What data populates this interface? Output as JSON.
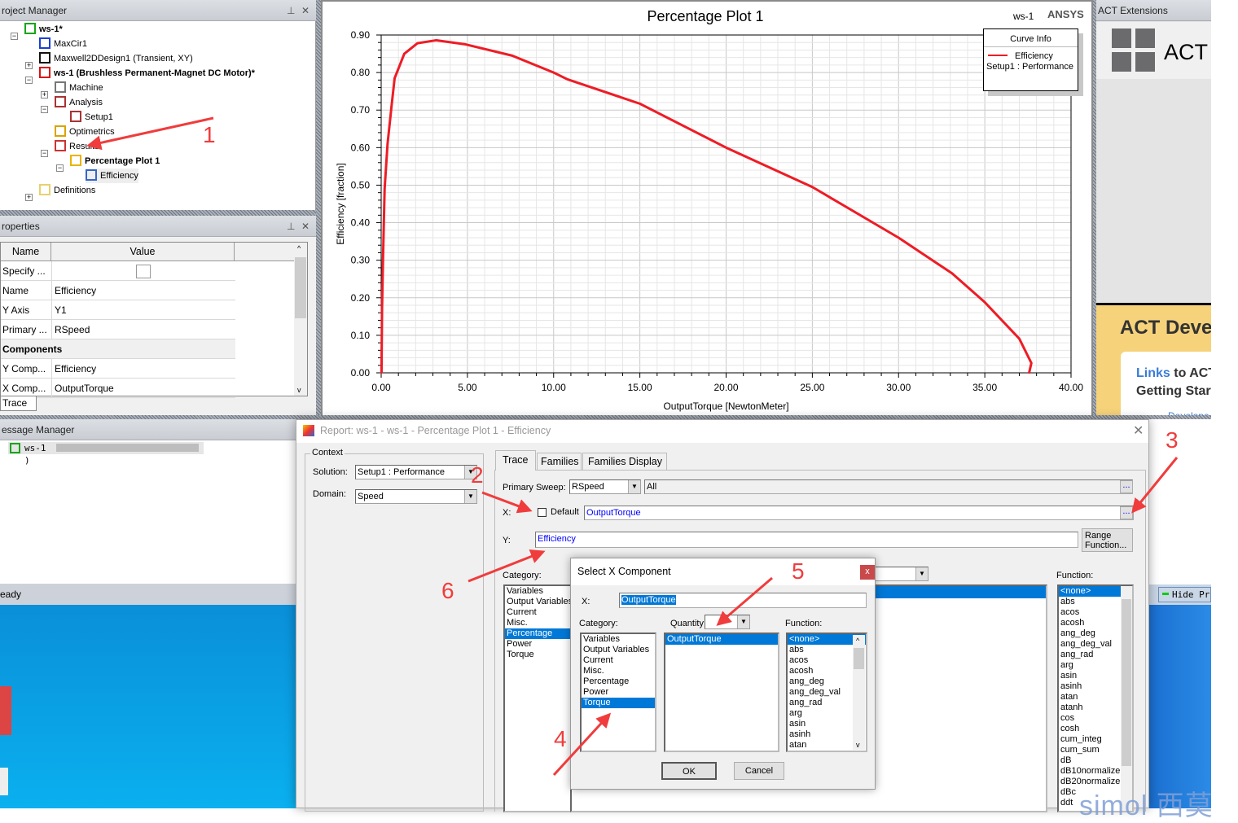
{
  "project_manager": {
    "title": "roject Manager",
    "pin_icon": "pin-icon",
    "tree": [
      {
        "label": "ws-1*",
        "bold": true,
        "icon": "project-icon"
      },
      {
        "label": "MaxCir1",
        "icon": "circuit-icon"
      },
      {
        "label": "Maxwell2DDesign1 (Transient, XY)",
        "icon": "maxwell-design-icon"
      },
      {
        "label": "ws-1 (Brushless Permanent-Magnet DC Motor)*",
        "bold": true,
        "icon": "rmxprt-icon"
      },
      {
        "label": "Machine",
        "icon": "machine-icon"
      },
      {
        "label": "Analysis",
        "icon": "analysis-icon"
      },
      {
        "label": "Setup1",
        "icon": "setup-icon"
      },
      {
        "label": "Optimetrics",
        "icon": "optimetrics-icon"
      },
      {
        "label": "Results",
        "icon": "results-icon"
      },
      {
        "label": "Percentage Plot 1",
        "bold": true,
        "icon": "plot-icon"
      },
      {
        "label": "Efficiency",
        "icon": "trace-icon"
      },
      {
        "label": "Definitions",
        "icon": "folder-icon"
      }
    ]
  },
  "properties": {
    "title": "roperties",
    "col_name": "Name",
    "col_value": "Value",
    "rows": [
      {
        "name": "Specify ...",
        "value": ""
      },
      {
        "name": "Name",
        "value": "Efficiency"
      },
      {
        "name": "Y Axis",
        "value": "Y1"
      },
      {
        "name": "Primary ...",
        "value": "RSpeed"
      },
      {
        "name": "Components",
        "value": "",
        "section": true
      },
      {
        "name": "Y Comp...",
        "value": "Efficiency"
      },
      {
        "name": "X Comp...",
        "value": "OutputTorque"
      }
    ],
    "tab": "Trace"
  },
  "chart_header": {
    "design": "ws-1",
    "brand": "ANSYS"
  },
  "legend": {
    "title": "Curve Info",
    "trace": "Efficiency",
    "solution": "Setup1 : Performance"
  },
  "chart_data": {
    "type": "line",
    "title": "Percentage Plot 1",
    "xlabel": "OutputTorque [NewtonMeter]",
    "ylabel": "Efficiency [fraction]",
    "xlim": [
      0,
      40
    ],
    "ylim": [
      0,
      0.9
    ],
    "xticks": [
      "0.00",
      "5.00",
      "10.00",
      "15.00",
      "20.00",
      "25.00",
      "30.00",
      "35.00",
      "40.00"
    ],
    "yticks": [
      "0.00",
      "0.10",
      "0.20",
      "0.30",
      "0.40",
      "0.50",
      "0.60",
      "0.70",
      "0.80",
      "0.90"
    ],
    "grid": true,
    "legend_position": "top-right",
    "series": [
      {
        "name": "Efficiency",
        "color": "#ee1c25",
        "x": [
          0.02,
          0.05,
          0.1,
          0.15,
          0.2,
          0.37,
          0.6,
          0.78,
          1.34,
          2.1,
          3.2,
          4.9,
          7.6,
          10.0,
          10.8,
          15.0,
          20.0,
          25.0,
          30.0,
          33.1,
          35.0,
          37.0,
          37.7,
          37.57
        ],
        "y": [
          0.0,
          0.17,
          0.29,
          0.39,
          0.49,
          0.61,
          0.71,
          0.785,
          0.85,
          0.878,
          0.886,
          0.875,
          0.845,
          0.8,
          0.782,
          0.717,
          0.6,
          0.495,
          0.36,
          0.265,
          0.188,
          0.091,
          0.026,
          0.0
        ]
      }
    ]
  },
  "act": {
    "title": "ACT Extensions",
    "logo_text": "ACT",
    "banner": "ACT Deve",
    "links_word": "Links",
    "links_rest": " to ACT",
    "getting": "Getting Start",
    "bullet": "Develope"
  },
  "message_manager": {
    "title": "essage Manager",
    "item": "ws-1",
    "item_suffix": ")"
  },
  "status": {
    "text": "eady"
  },
  "taskbar": {
    "hide_button": "Hide Pr"
  },
  "report_dialog": {
    "title": "Report: ws-1 - ws-1 - Percentage Plot 1 - Efficiency",
    "context_label": "Context",
    "solution_label": "Solution:",
    "solution_value": "Setup1 : Performance",
    "domain_label": "Domain:",
    "domain_value": "Speed",
    "tabs": [
      "Trace",
      "Families",
      "Families Display"
    ],
    "primary_sweep_label": "Primary Sweep:",
    "primary_sweep_value": "RSpeed",
    "sweep_range": "All",
    "ellipsis": "...",
    "x_label": "X:",
    "default_label": "Default",
    "default_checked": false,
    "x_value": "OutputTorque",
    "y_label": "Y:",
    "y_value": "Efficiency",
    "range_function": "Range Function...",
    "category_label": "Category:",
    "categories": [
      "Variables",
      "Output Variables",
      "Current",
      "Misc.",
      "Percentage",
      "Power",
      "Torque"
    ],
    "selected_category": "Percentage",
    "function_label": "Function:",
    "functions": [
      "<none>",
      "abs",
      "acos",
      "acosh",
      "ang_deg",
      "ang_deg_val",
      "ang_rad",
      "arg",
      "asin",
      "asinh",
      "atan",
      "atanh",
      "cos",
      "cosh",
      "cum_integ",
      "cum_sum",
      "dB",
      "dB10normalize",
      "dB20normalize",
      "dBc",
      "ddt"
    ]
  },
  "select_x_dialog": {
    "title": "Select X Component",
    "x_label": "X:",
    "x_value": "OutputTorque",
    "category_label": "Category:",
    "categories": [
      "Variables",
      "Output Variables",
      "Current",
      "Misc.",
      "Percentage",
      "Power",
      "Torque"
    ],
    "selected_category": "Torque",
    "quantity_label": "Quantity",
    "quantities": [
      "OutputTorque"
    ],
    "function_label": "Function:",
    "functions": [
      "<none>",
      "abs",
      "acos",
      "acosh",
      "ang_deg",
      "ang_deg_val",
      "ang_rad",
      "arg",
      "asin",
      "asinh",
      "atan"
    ],
    "ok": "OK",
    "cancel": "Cancel",
    "close": "x"
  },
  "annotations": [
    "1",
    "2",
    "3",
    "4",
    "5",
    "6"
  ],
  "watermark": "simol 西莫",
  "colors": {
    "accent": "#0078d7",
    "annotation": "#f03c3c",
    "trace": "#ee1c25",
    "act_banner": "#f6d27a",
    "desktop": "#0aa0e6"
  }
}
